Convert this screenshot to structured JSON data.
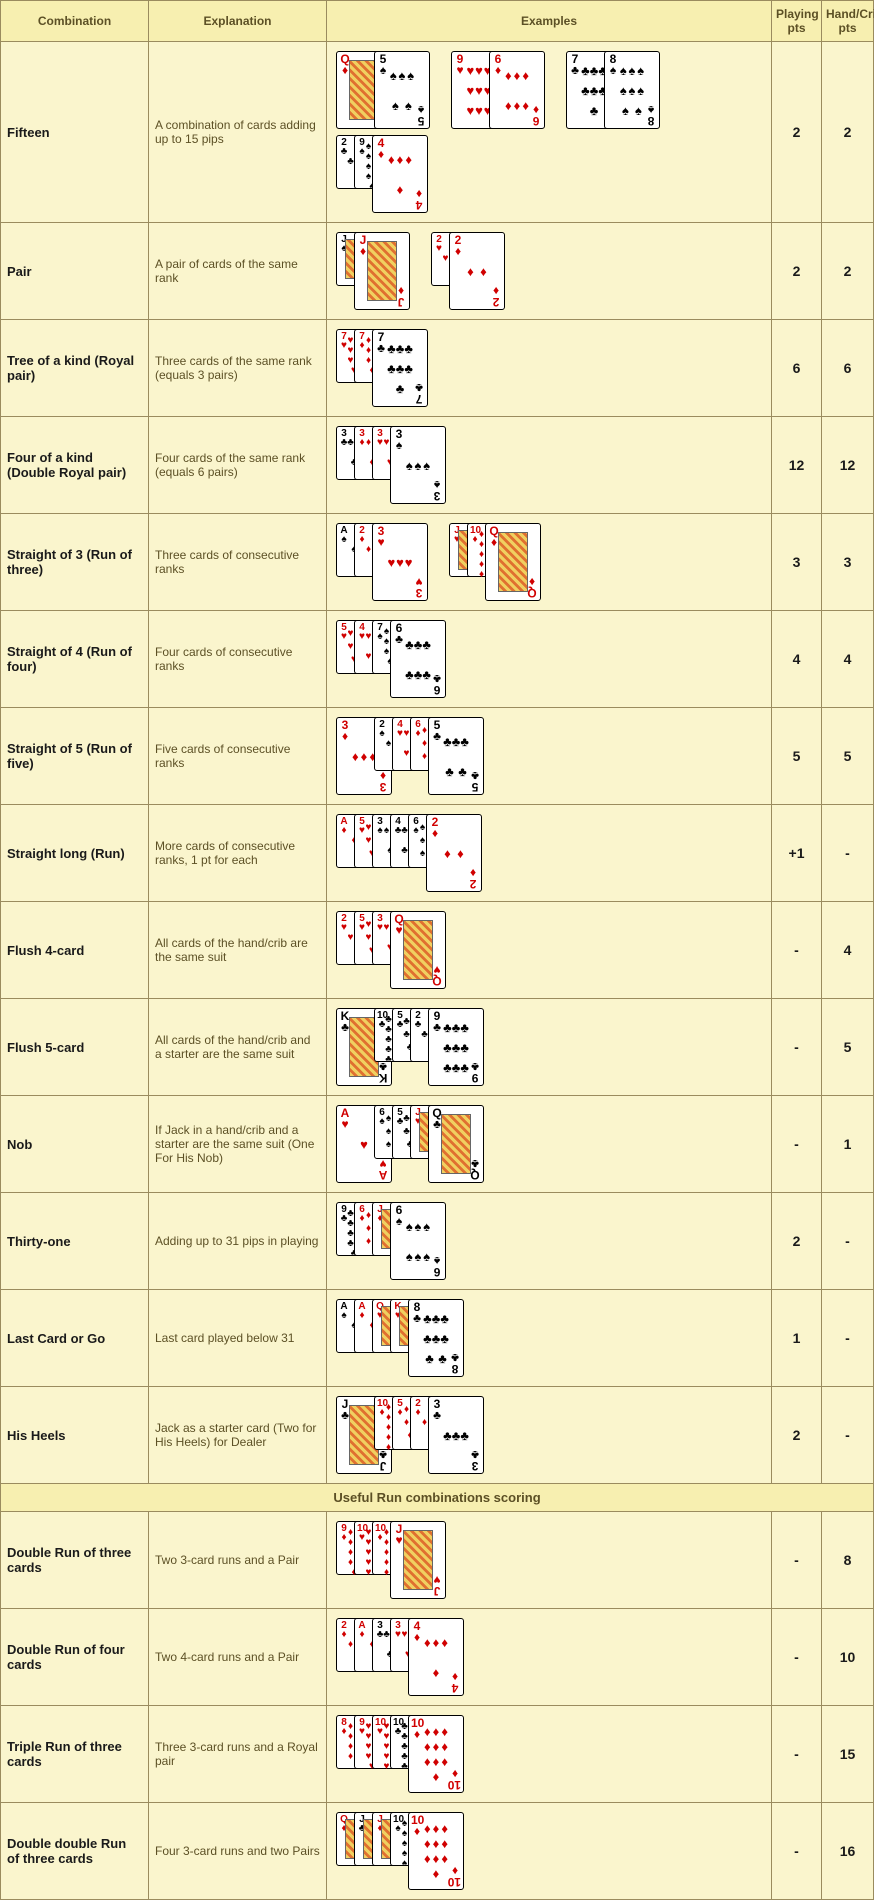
{
  "headers": {
    "combination": "Combination",
    "explanation": "Explanation",
    "examples": "Examples",
    "playing_pts": "Playing pts",
    "hand_crib_pts": "Hand/Crib pts"
  },
  "section_header": "Useful Run combinations scoring",
  "rows": [
    {
      "combo": "Fifteen",
      "explain": "A combination of cards adding up to 15 pips",
      "play": "2",
      "hand": "2",
      "examples": [
        [
          {
            "r": "Q",
            "s": "d",
            "big": true
          },
          {
            "r": "5",
            "s": "s",
            "big": true
          }
        ],
        [
          {
            "r": "9",
            "s": "h",
            "big": true
          },
          {
            "r": "6",
            "s": "d",
            "big": true
          }
        ],
        [
          {
            "r": "7",
            "s": "c",
            "big": true
          },
          {
            "r": "8",
            "s": "s",
            "big": true
          }
        ],
        [
          {
            "r": "2",
            "s": "c"
          },
          {
            "r": "9",
            "s": "s"
          },
          {
            "r": "4",
            "s": "d",
            "big": true
          }
        ]
      ]
    },
    {
      "combo": "Pair",
      "explain": "A pair of cards of the same rank",
      "play": "2",
      "hand": "2",
      "examples": [
        [
          {
            "r": "J",
            "s": "s"
          },
          {
            "r": "J",
            "s": "d",
            "big": true
          }
        ],
        [
          {
            "r": "2",
            "s": "h"
          },
          {
            "r": "2",
            "s": "d",
            "big": true
          }
        ]
      ]
    },
    {
      "combo": "Tree of a kind (Royal pair)",
      "explain": "Three cards of the same rank (equals 3 pairs)",
      "play": "6",
      "hand": "6",
      "examples": [
        [
          {
            "r": "7",
            "s": "h"
          },
          {
            "r": "7",
            "s": "d"
          },
          {
            "r": "7",
            "s": "c",
            "big": true
          }
        ]
      ]
    },
    {
      "combo": "Four of a kind (Double Royal pair)",
      "explain": "Four cards of the same rank (equals 6 pairs)",
      "play": "12",
      "hand": "12",
      "examples": [
        [
          {
            "r": "3",
            "s": "c"
          },
          {
            "r": "3",
            "s": "d"
          },
          {
            "r": "3",
            "s": "h"
          },
          {
            "r": "3",
            "s": "s",
            "big": true
          }
        ]
      ]
    },
    {
      "combo": "Straight of 3 (Run of three)",
      "explain": "Three cards of consecutive ranks",
      "play": "3",
      "hand": "3",
      "examples": [
        [
          {
            "r": "A",
            "s": "s"
          },
          {
            "r": "2",
            "s": "d"
          },
          {
            "r": "3",
            "s": "h",
            "big": true
          }
        ],
        [
          {
            "r": "J",
            "s": "h"
          },
          {
            "r": "10",
            "s": "d"
          },
          {
            "r": "Q",
            "s": "d",
            "big": true
          }
        ]
      ]
    },
    {
      "combo": "Straight of 4 (Run of four)",
      "explain": "Four cards of consecutive ranks",
      "play": "4",
      "hand": "4",
      "examples": [
        [
          {
            "r": "5",
            "s": "h"
          },
          {
            "r": "4",
            "s": "h"
          },
          {
            "r": "7",
            "s": "s"
          },
          {
            "r": "6",
            "s": "c",
            "big": true
          }
        ]
      ]
    },
    {
      "combo": "Straight of 5 (Run of five)",
      "explain": "Five cards of consecutive ranks",
      "play": "5",
      "hand": "5",
      "examples": [
        [
          {
            "r": "3",
            "s": "d",
            "big": true
          },
          {
            "r": "2",
            "s": "s"
          },
          {
            "r": "4",
            "s": "h"
          },
          {
            "r": "6",
            "s": "d"
          },
          {
            "r": "5",
            "s": "c",
            "big": true
          }
        ]
      ]
    },
    {
      "combo": "Straight long (Run)",
      "explain": "More cards of consecutive ranks, 1 pt for each",
      "play": "+1",
      "hand": "-",
      "examples": [
        [
          {
            "r": "A",
            "s": "d"
          },
          {
            "r": "5",
            "s": "h"
          },
          {
            "r": "3",
            "s": "s"
          },
          {
            "r": "4",
            "s": "c"
          },
          {
            "r": "6",
            "s": "s"
          },
          {
            "r": "2",
            "s": "d",
            "big": true
          }
        ]
      ]
    },
    {
      "combo": "Flush 4-card",
      "explain": "All cards of the hand/crib are the same suit",
      "play": "-",
      "hand": "4",
      "examples": [
        [
          {
            "r": "2",
            "s": "h"
          },
          {
            "r": "5",
            "s": "h"
          },
          {
            "r": "3",
            "s": "h"
          },
          {
            "r": "Q",
            "s": "h",
            "big": true
          }
        ]
      ]
    },
    {
      "combo": "Flush 5-card",
      "explain": "All cards of the hand/crib and a starter are the same suit",
      "play": "-",
      "hand": "5",
      "examples": [
        [
          {
            "r": "K",
            "s": "c",
            "big": true
          },
          {
            "r": "10",
            "s": "c"
          },
          {
            "r": "5",
            "s": "c"
          },
          {
            "r": "2",
            "s": "c"
          },
          {
            "r": "9",
            "s": "c",
            "big": true
          }
        ]
      ]
    },
    {
      "combo": "Nob",
      "explain": "If Jack in a hand/crib and a starter are the same suit (One For His Nob)",
      "play": "-",
      "hand": "1",
      "examples": [
        [
          {
            "r": "A",
            "s": "h",
            "big": true
          },
          {
            "r": "6",
            "s": "s"
          },
          {
            "r": "5",
            "s": "c"
          },
          {
            "r": "J",
            "s": "h"
          },
          {
            "r": "Q",
            "s": "c",
            "big": true
          }
        ]
      ]
    },
    {
      "combo": "Thirty-one",
      "explain": "Adding up to 31 pips in playing",
      "play": "2",
      "hand": "-",
      "examples": [
        [
          {
            "r": "9",
            "s": "c"
          },
          {
            "r": "6",
            "s": "d"
          },
          {
            "r": "J",
            "s": "d"
          },
          {
            "r": "6",
            "s": "s",
            "big": true
          }
        ]
      ]
    },
    {
      "combo": "Last Card or Go",
      "explain": "Last card played below 31",
      "play": "1",
      "hand": "-",
      "examples": [
        [
          {
            "r": "A",
            "s": "s"
          },
          {
            "r": "A",
            "s": "d"
          },
          {
            "r": "Q",
            "s": "h"
          },
          {
            "r": "K",
            "s": "h"
          },
          {
            "r": "8",
            "s": "c",
            "big": true
          }
        ]
      ]
    },
    {
      "combo": "His Heels",
      "explain": "Jack as a starter card (Two for His Heels) for Dealer",
      "play": "2",
      "hand": "-",
      "examples": [
        [
          {
            "r": "J",
            "s": "c",
            "big": true
          },
          {
            "r": "10",
            "s": "d"
          },
          {
            "r": "5",
            "s": "d"
          },
          {
            "r": "2",
            "s": "d"
          },
          {
            "r": "3",
            "s": "c",
            "big": true
          }
        ]
      ]
    }
  ],
  "run_rows": [
    {
      "combo": "Double Run of three cards",
      "explain": "Two 3-card runs and a Pair",
      "play": "-",
      "hand": "8",
      "examples": [
        [
          {
            "r": "9",
            "s": "d"
          },
          {
            "r": "10",
            "s": "h"
          },
          {
            "r": "10",
            "s": "d"
          },
          {
            "r": "J",
            "s": "h",
            "big": true
          }
        ]
      ]
    },
    {
      "combo": "Double Run of four cards",
      "explain": "Two 4-card runs and a Pair",
      "play": "-",
      "hand": "10",
      "examples": [
        [
          {
            "r": "2",
            "s": "d"
          },
          {
            "r": "A",
            "s": "d"
          },
          {
            "r": "3",
            "s": "c"
          },
          {
            "r": "3",
            "s": "h"
          },
          {
            "r": "4",
            "s": "d",
            "big": true
          }
        ]
      ]
    },
    {
      "combo": "Triple Run of three cards",
      "explain": "Three 3-card runs and a Royal pair",
      "play": "-",
      "hand": "15",
      "examples": [
        [
          {
            "r": "8",
            "s": "d"
          },
          {
            "r": "9",
            "s": "h"
          },
          {
            "r": "10",
            "s": "h"
          },
          {
            "r": "10",
            "s": "c"
          },
          {
            "r": "10",
            "s": "d",
            "big": true
          }
        ]
      ]
    },
    {
      "combo": "Double double Run of three cards",
      "explain": "Four 3-card runs and two Pairs",
      "play": "-",
      "hand": "16",
      "examples": [
        [
          {
            "r": "Q",
            "s": "d"
          },
          {
            "r": "J",
            "s": "c"
          },
          {
            "r": "J",
            "s": "d"
          },
          {
            "r": "10",
            "s": "s"
          },
          {
            "r": "10",
            "s": "d",
            "big": true
          }
        ]
      ]
    }
  ]
}
